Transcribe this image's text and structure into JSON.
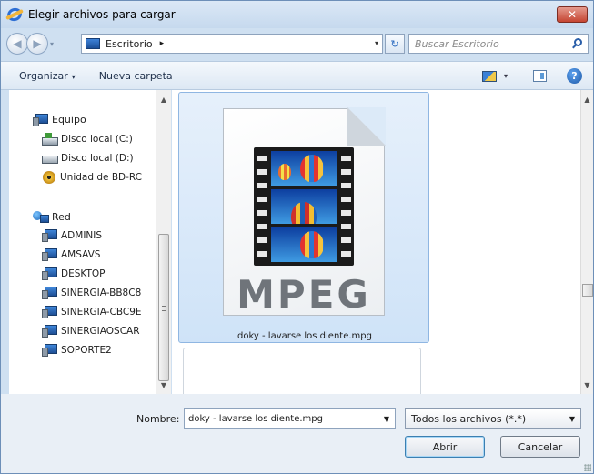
{
  "window": {
    "title": "Elegir archivos para cargar",
    "close_label": "✕"
  },
  "navigation": {
    "address": {
      "location": "Escritorio",
      "arrow": "▸",
      "dropdown": "▾"
    },
    "refresh": "↻",
    "search": {
      "placeholder": "Buscar Escritorio"
    }
  },
  "toolbar": {
    "organize_label": "Organizar",
    "organize_caret": "▾",
    "new_folder_label": "Nueva carpeta",
    "view_caret": "▾",
    "help_label": "?"
  },
  "nav_pane": {
    "computer": {
      "label": "Equipo",
      "drives": [
        {
          "label": "Disco local (C:)",
          "icon": "hard-drive-icon"
        },
        {
          "label": "Disco local (D:)",
          "icon": "drive-icon"
        },
        {
          "label": "Unidad de BD-RC",
          "icon": "disc-drive-icon"
        }
      ]
    },
    "network": {
      "label": "Red",
      "computers": [
        "ADMINIS",
        "AMSAVS",
        "DESKTOP",
        "SINERGIA-BB8C8",
        "SINERGIA-CBC9E",
        "SINERGIAOSCAR",
        "SOPORTE2"
      ]
    }
  },
  "files": [
    {
      "name": "doky - lavarse los diente.mpg",
      "type_label": "MPEG",
      "selected": true
    }
  ],
  "footer": {
    "name_label": "Nombre:",
    "name_value": "doky - lavarse los diente.mpg",
    "file_type": "Todos los archivos (*.*)",
    "open_label": "Abrir",
    "cancel_label": "Cancelar"
  },
  "colors": {
    "selection_bg": "#cfe3f8",
    "selection_border": "#8fb6e2",
    "frame_bg": "#cfe0f1"
  }
}
